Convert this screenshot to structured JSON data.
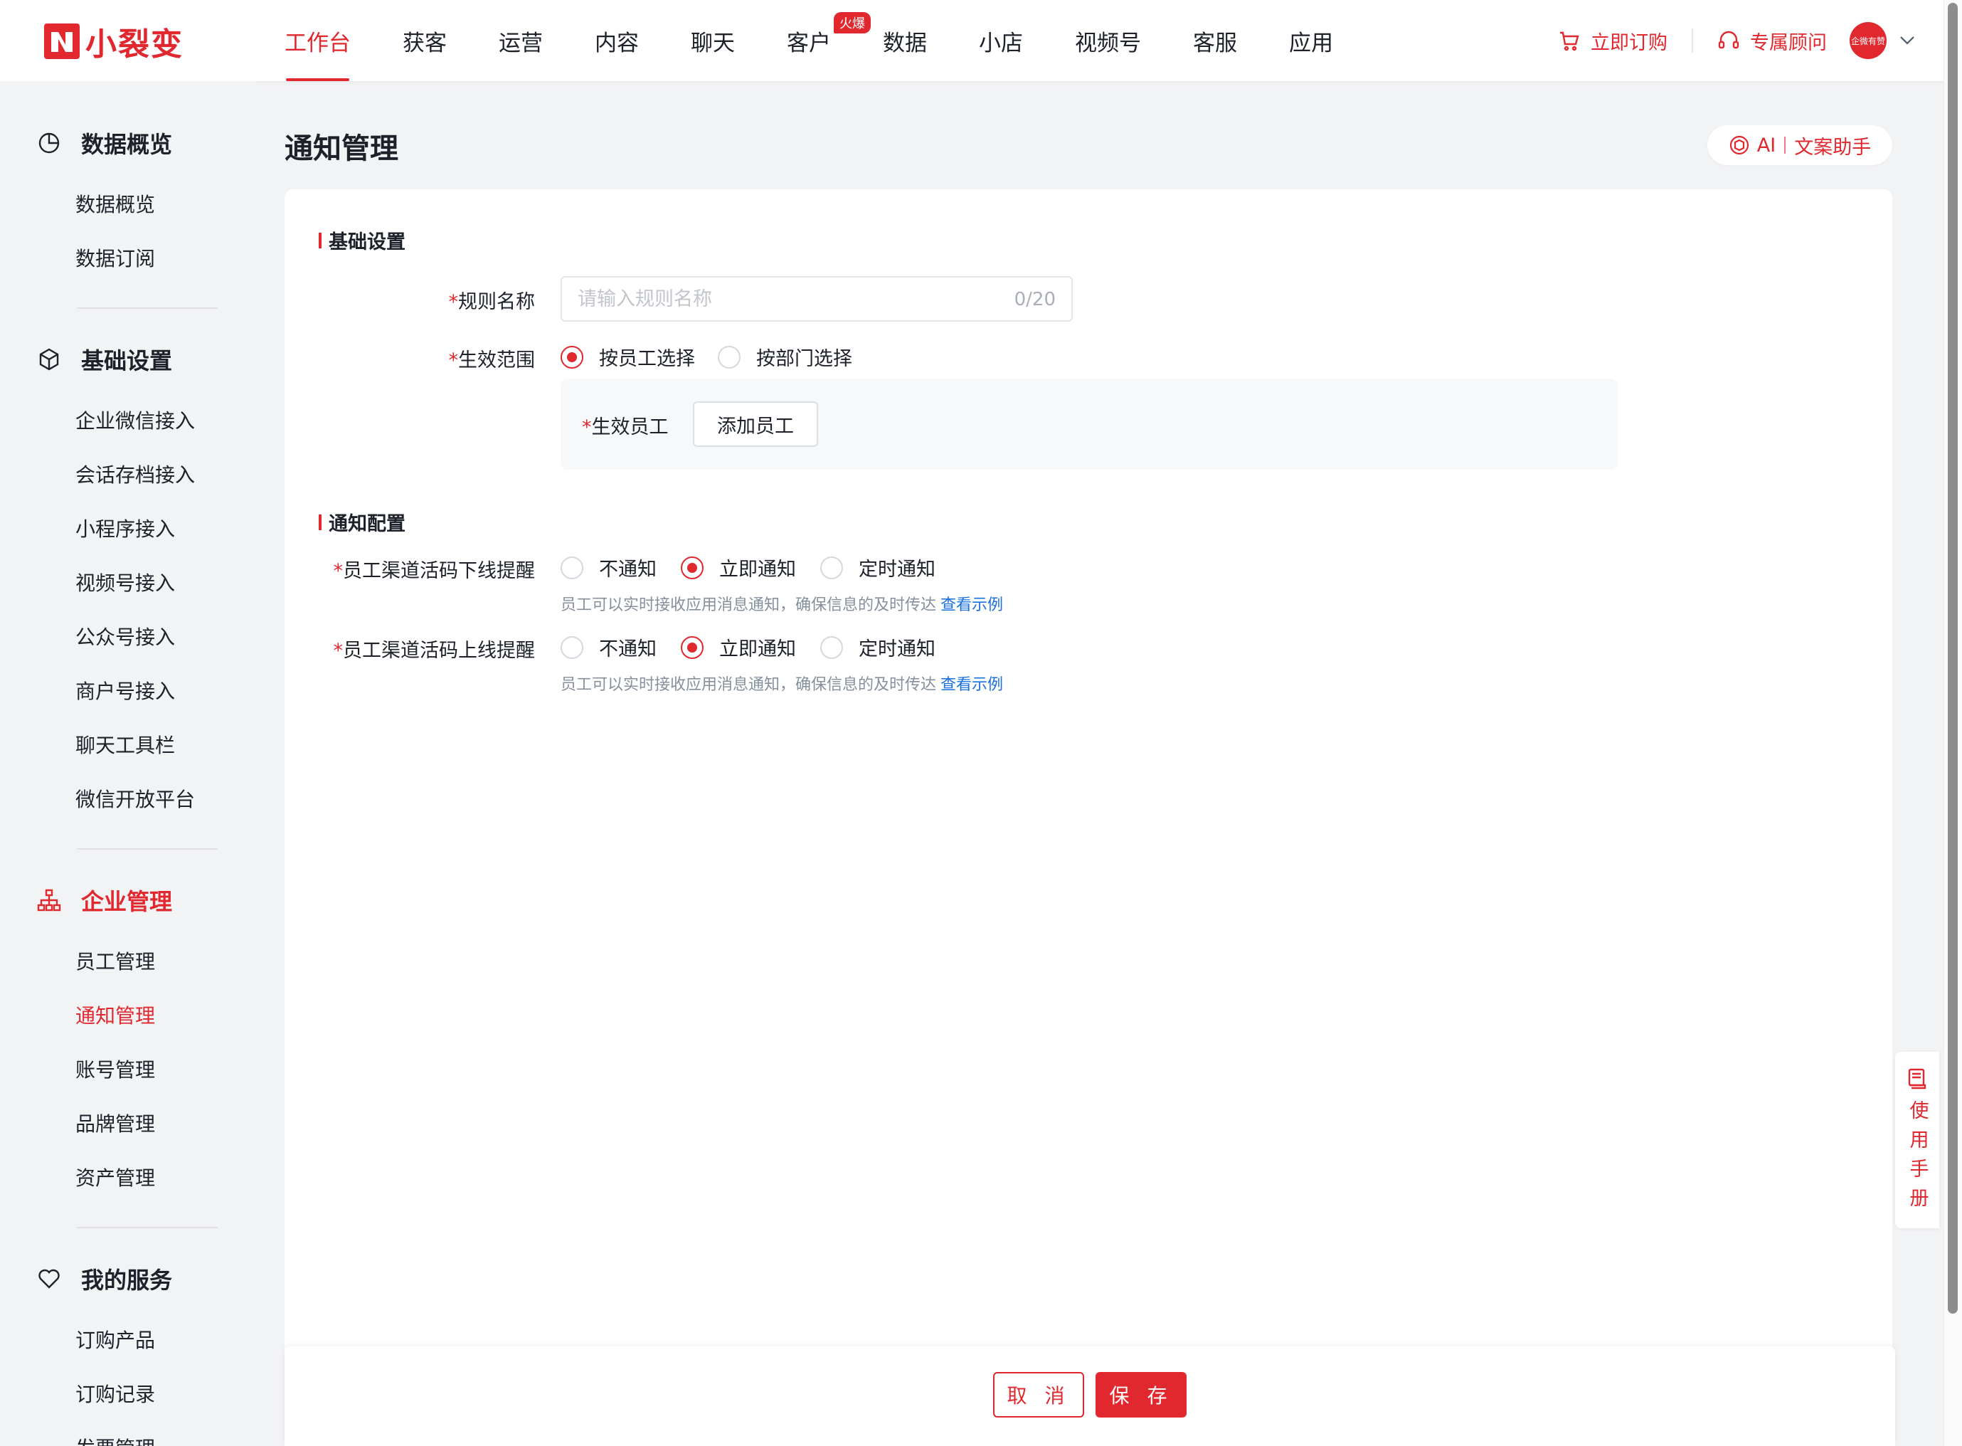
{
  "brand": {
    "name": "小裂变",
    "color": "#e0282e"
  },
  "nav": {
    "items": [
      {
        "label": "工作台",
        "active": true
      },
      {
        "label": "获客"
      },
      {
        "label": "运营"
      },
      {
        "label": "内容"
      },
      {
        "label": "聊天"
      },
      {
        "label": "客户",
        "badge": "火爆"
      },
      {
        "label": "数据"
      },
      {
        "label": "小店"
      },
      {
        "label": "视频号"
      },
      {
        "label": "客服"
      },
      {
        "label": "应用"
      }
    ],
    "order_now": "立即订购",
    "advisor": "专属顾问",
    "avatar_text": "企微有赞"
  },
  "sidebar": {
    "groups": [
      {
        "title": "数据概览",
        "icon": "pie-chart-icon",
        "items": [
          "数据概览",
          "数据订阅"
        ]
      },
      {
        "title": "基础设置",
        "icon": "cube-icon",
        "items": [
          "企业微信接入",
          "会话存档接入",
          "小程序接入",
          "视频号接入",
          "公众号接入",
          "商户号接入",
          "聊天工具栏",
          "微信开放平台"
        ]
      },
      {
        "title": "企业管理",
        "icon": "org-chart-icon",
        "active": true,
        "items": [
          "员工管理",
          "通知管理",
          "账号管理",
          "品牌管理",
          "资产管理"
        ],
        "active_item": "通知管理"
      },
      {
        "title": "我的服务",
        "icon": "heart-icon",
        "items": [
          "订购产品",
          "订购记录",
          "发票管理"
        ]
      }
    ]
  },
  "page": {
    "title": "通知管理",
    "ai_label": "AI",
    "ai_assistant": "文案助手"
  },
  "form": {
    "basic_section": "基础设置",
    "rule_name_label": "规则名称",
    "rule_name_placeholder": "请输入规则名称",
    "rule_name_value": "",
    "rule_name_counter": "0/20",
    "scope_label": "生效范围",
    "scope_options": [
      "按员工选择",
      "按部门选择"
    ],
    "scope_selected": "按员工选择",
    "employee_label": "生效员工",
    "add_employee": "添加员工",
    "notify_section": "通知配置",
    "offline_label": "员工渠道活码下线提醒",
    "online_label": "员工渠道活码上线提醒",
    "notify_options": [
      "不通知",
      "立即通知",
      "定时通知"
    ],
    "offline_selected": "立即通知",
    "online_selected": "立即通知",
    "hint": "员工可以实时接收应用消息通知，确保信息的及时传达",
    "hint_link": "查看示例"
  },
  "footer": {
    "cancel": "取 消",
    "save": "保 存"
  },
  "manual": {
    "label": "使用手册"
  }
}
